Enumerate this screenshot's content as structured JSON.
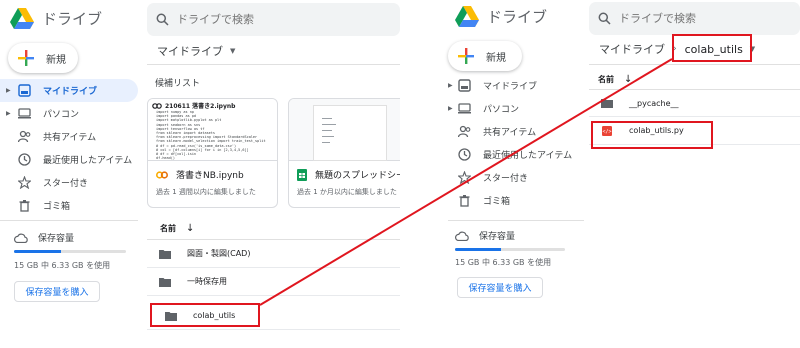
{
  "left": {
    "app_name": "ドライブ",
    "search_placeholder": "ドライブで検索",
    "new_button": "新規",
    "nav": [
      {
        "label": "マイドライブ",
        "icon": "my-drive-icon",
        "active": true
      },
      {
        "label": "パソコン",
        "icon": "computer-icon"
      },
      {
        "label": "共有アイテム",
        "icon": "shared-icon"
      },
      {
        "label": "最近使用したアイテム",
        "icon": "recent-icon"
      },
      {
        "label": "スター付き",
        "icon": "star-icon"
      },
      {
        "label": "ゴミ箱",
        "icon": "trash-icon"
      }
    ],
    "storage_label": "保存容量",
    "storage_usage": "15 GB 中 6.33 GB を使用",
    "storage_fraction": 0.42,
    "buy_storage": "保存容量を購入",
    "breadcrumb": "マイドライブ",
    "suggested_label": "候補リスト",
    "cards": [
      {
        "header": "210611 落書き2.ipynb",
        "name": "落書きNB.ipynb",
        "meta": "過去 1 週間以内に編集しました",
        "icon": "colab-icon"
      },
      {
        "header": "",
        "name": "無題のスプレッドシート",
        "meta": "過去 1 か月以内に編集しました",
        "icon": "sheets-icon"
      }
    ],
    "name_header": "名前",
    "folders": [
      {
        "name": "図面・製図(CAD)"
      },
      {
        "name": "一時保存用"
      },
      {
        "name": "colab_utils"
      }
    ],
    "code_preview": [
      "import numpy as np",
      "import pandas as pd",
      "import matplotlib.pyplot as plt",
      "import seaborn as sns",
      "import tensorflow as tf",
      "from sklearn import datasets",
      "from sklearn.preprocessing import StandardScaler",
      "from sklearn.model_selection import train_test_split",
      "# df = pd.read_csv('is_some_data.csv')",
      "# col = [df.columns[i] for i in [2,3,4,5,6]]",
      "# df = df[col].isin",
      "df.head()"
    ]
  },
  "right": {
    "app_name": "ドライブ",
    "search_placeholder": "ドライブで検索",
    "new_button": "新規",
    "nav": [
      {
        "label": "マイドライブ",
        "icon": "my-drive-icon"
      },
      {
        "label": "パソコン",
        "icon": "computer-icon"
      },
      {
        "label": "共有アイテム",
        "icon": "shared-icon"
      },
      {
        "label": "最近使用したアイテム",
        "icon": "recent-icon"
      },
      {
        "label": "スター付き",
        "icon": "star-icon"
      },
      {
        "label": "ゴミ箱",
        "icon": "trash-icon"
      }
    ],
    "storage_label": "保存容量",
    "storage_usage": "15 GB 中 6.33 GB を使用",
    "storage_fraction": 0.42,
    "buy_storage": "保存容量を購入",
    "breadcrumb_root": "マイドライブ",
    "breadcrumb_current": "colab_utils",
    "name_header": "名前",
    "items": [
      {
        "name": "__pycache__",
        "type": "folder"
      },
      {
        "name": "colab_utils.py",
        "type": "python"
      }
    ]
  },
  "colors": {
    "accent": "#1a73e8",
    "highlight": "#e0161f",
    "active_bg": "#e8f0fe"
  }
}
